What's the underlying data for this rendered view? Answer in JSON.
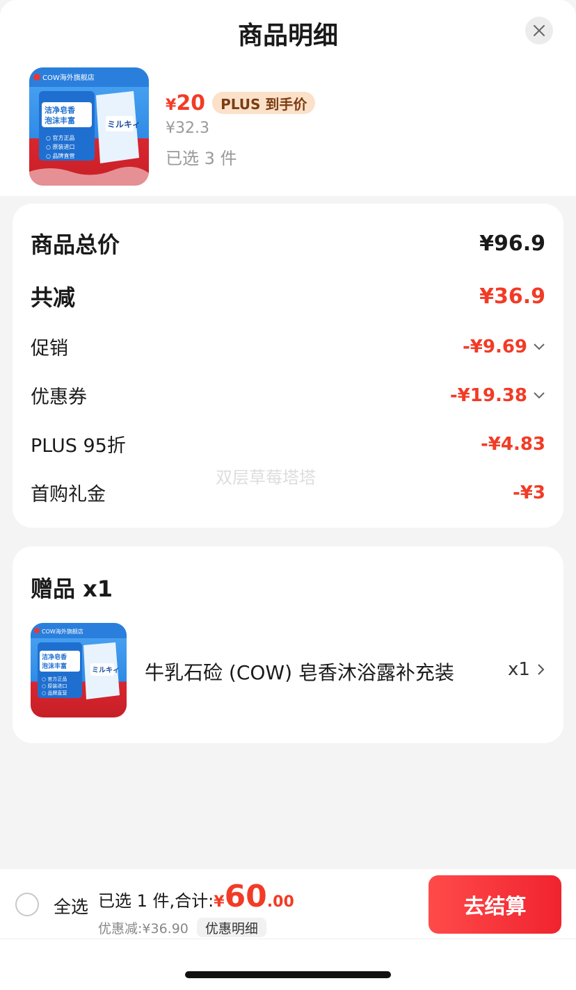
{
  "header": {
    "title": "商品明细",
    "close_icon": "close-icon"
  },
  "product": {
    "currency": "¥",
    "price_now": "20",
    "plus_tag": "PLUS 到手价",
    "price_original": "¥32.3",
    "selected": "已选 3 件",
    "thumb_brand": "COW海外旗舰店",
    "thumb_slogan": "洁净皂香 泡沫丰富",
    "thumb_features": [
      "官方正品",
      "原装进口",
      "品牌直营"
    ],
    "thumb_product": "ミルキィ"
  },
  "summary": {
    "total_label": "商品总价",
    "total_value": "¥96.9",
    "reduce_label": "共减",
    "reduce_value": "¥36.9",
    "items": [
      {
        "label": "促销",
        "value": "-¥9.69",
        "expandable": true
      },
      {
        "label": "优惠券",
        "value": "-¥19.38",
        "expandable": true
      },
      {
        "label": "PLUS 95折",
        "value": "-¥4.83",
        "expandable": false
      },
      {
        "label": "首购礼金",
        "value": "-¥3",
        "expandable": false
      }
    ],
    "watermark": "双层草莓塔塔"
  },
  "gift": {
    "title": "赠品 x1",
    "name": "牛乳石硷 (COW) 皂香沐浴露补充装",
    "qty": "x1",
    "thumb_brand": "COW海外旗舰店",
    "thumb_slogan": "洁净皂香 泡沫丰富",
    "thumb_features": [
      "官方正品",
      "原装进口",
      "品牌直营"
    ],
    "thumb_product": "ミルキィ"
  },
  "footer": {
    "select_all": "全选",
    "summary_text": "已选 1 件,合计:",
    "currency": "¥",
    "total_int": "60",
    "total_dec": ".00",
    "discount_text": "优惠减:¥36.90",
    "detail_chip": "优惠明细",
    "checkout": "去结算"
  },
  "colors": {
    "accent_red": "#f23b26",
    "plus_tag_bg": "#fbe1c9",
    "checkout_red": "#f0232f"
  }
}
